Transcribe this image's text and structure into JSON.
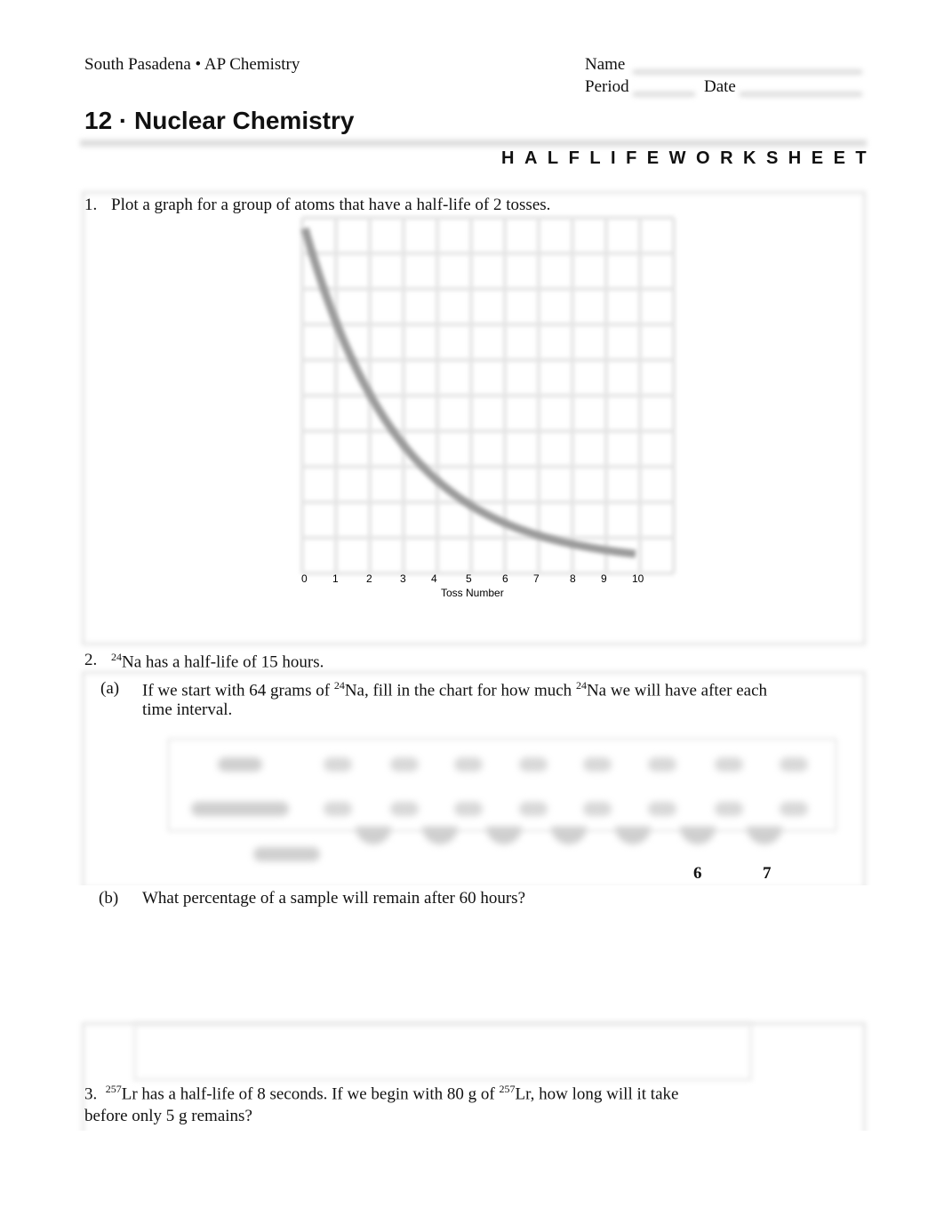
{
  "header": {
    "school": "South Pasadena • AP Chemistry",
    "name_label": "Name",
    "period_label": "Period",
    "date_label": "Date"
  },
  "title": "12 · Nuclear Chemistry",
  "subtitle": "HALFLIFEWORKSHEET",
  "q1": {
    "number": "1.",
    "text": "Plot a graph for a group of atoms that have a half-life of 2 tosses."
  },
  "chart_data": {
    "type": "line",
    "xlabel": "Toss Number",
    "x": [
      0,
      1,
      2,
      3,
      4,
      5,
      6,
      7,
      8,
      9,
      10
    ],
    "xticks": [
      "0",
      "1",
      "2",
      "3",
      "4",
      "5",
      "6",
      "7",
      "8",
      "9",
      "10"
    ],
    "half_life_tosses": 2,
    "grid": true,
    "stroke_color": "#999999"
  },
  "q2": {
    "number": "2.",
    "iso_mass": "24",
    "iso_rest": "Na has a half-life of 15 hours.",
    "a_label": "(a)",
    "a_text1": "If we start with 64 grams of ",
    "a_sup1": "24",
    "a_text2": "Na, fill in the chart for how much ",
    "a_sup2": "24",
    "a_text3": "Na we will have after each",
    "a_text4": "time interval.",
    "visible_numbers": [
      "6",
      "7"
    ],
    "b_label": "(b)",
    "b_text": "What percentage of a sample will remain after 60 hours?"
  },
  "q3": {
    "number": "3.",
    "sup1": "257",
    "text1": "Lr has a half-life of 8 seconds.  If we begin with 80 g of ",
    "sup2": "257",
    "text2": "Lr, how long will it take",
    "text3": "before only 5 g remains?"
  }
}
